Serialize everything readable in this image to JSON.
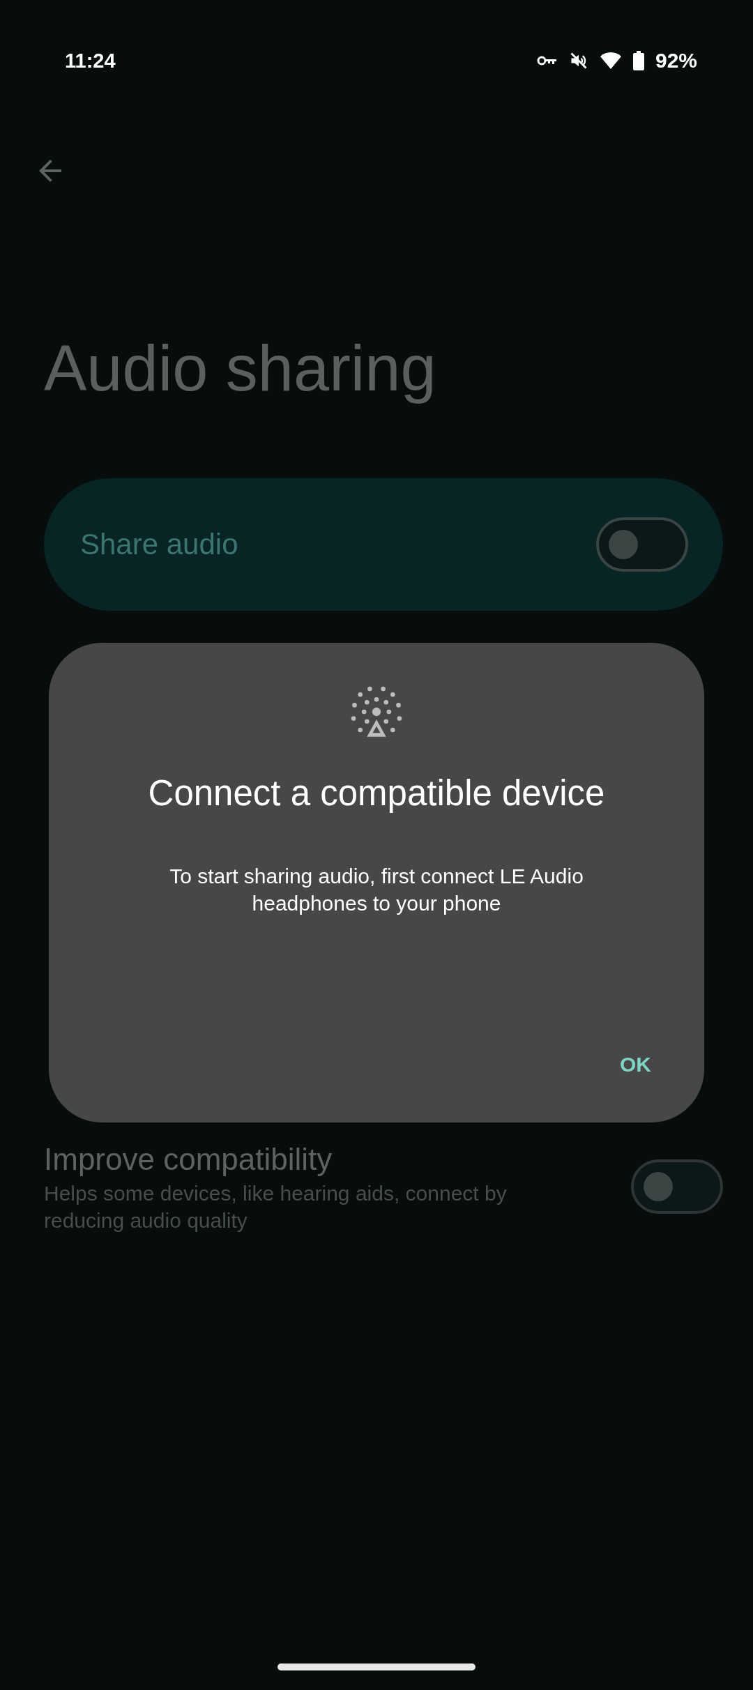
{
  "status_bar": {
    "time": "11:24",
    "battery": "92%"
  },
  "page": {
    "title": "Audio sharing"
  },
  "share_audio": {
    "label": "Share audio",
    "on": false
  },
  "improve_compatibility": {
    "title": "Improve compatibility",
    "subtitle": "Helps some devices, like hearing aids, connect by reducing audio quality",
    "on": false
  },
  "dialog": {
    "title": "Connect a compatible device",
    "message": "To start sharing audio, first connect LE Audio headphones to your phone",
    "button": "OK"
  }
}
